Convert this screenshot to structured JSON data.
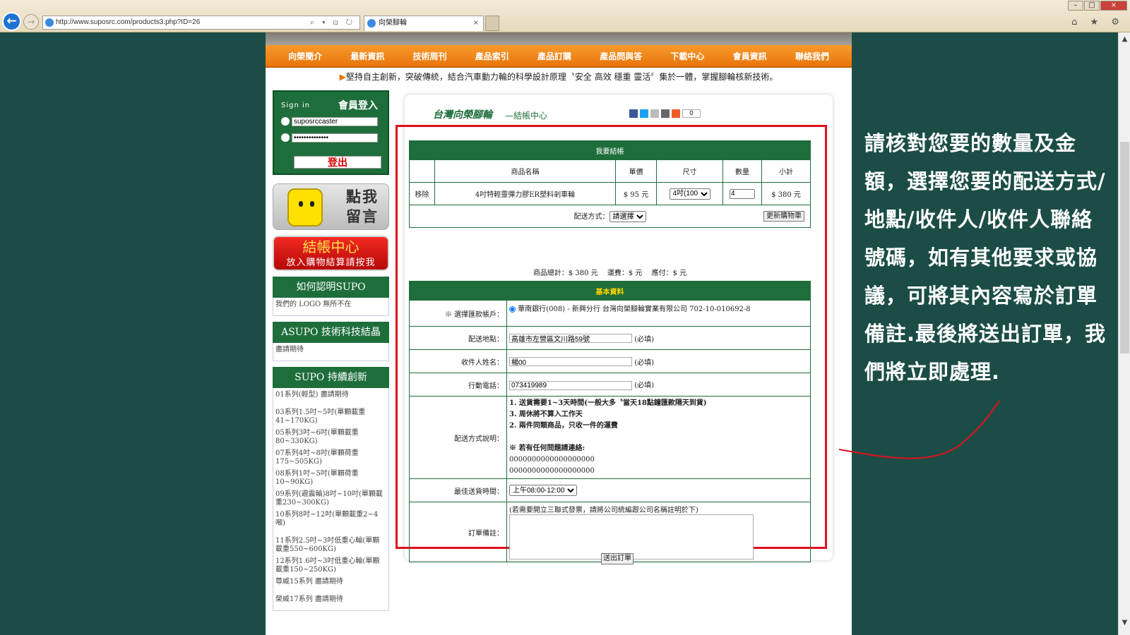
{
  "browser": {
    "url": "http://www.suposrc.com/products3.php?ID=26",
    "tab_title": "向榮腳輪",
    "back_glyph": "←",
    "forward_glyph": "→",
    "close_glyph": "×",
    "min_glyph": "–",
    "max_glyph": "□",
    "addr_tools": "⌕ ▾ ⊡ ↻",
    "right_icons": "⌂ ★ ⚙",
    "scroll_up": "▲",
    "scroll_down": "▼"
  },
  "menu": [
    "向榮簡介",
    "最新資訊",
    "技術周刊",
    "產品索引",
    "產品訂購",
    "產品問與答",
    "下載中心",
    "會員資訊",
    "聯絡我們"
  ],
  "slogan": "堅持自主創新，突破傳統，結合汽車動力輪的科學設計原理〝安全 高效 穩重 靈活〞集於一體，掌握腳輪核新技術。",
  "slogan_marker": "▶",
  "login": {
    "signin": "Sign in",
    "title": "會員登入",
    "username": "suposrccaster",
    "password": "••••••••••••••",
    "logout": "登出"
  },
  "message_button": "點我留言",
  "checkout_button": {
    "title": "結帳中心",
    "subtitle": "放入購物結算請按我"
  },
  "sidebar_sections": [
    {
      "title": "如何認明SUPO",
      "items": [
        "我們的 LOGO 無所不在"
      ]
    },
    {
      "title": "ASUPO 技術科技結晶",
      "items": [
        "盡請期待"
      ]
    },
    {
      "title": "SUPO 持續創新",
      "items": [
        "01系列(輕型) 盡請期待",
        "03系列1.5吋~5吋(單顆載重41~170KG)",
        "05系列3吋~6吋(單顆載重80~330KG)",
        "07系列4吋~8吋(單顆荷重175~505KG)",
        "08系列1吋~5吋(單顆荷重10~90KG)",
        "09系列(避震輪)8吋~10吋(單顆載重230~300KG)",
        "10系列8吋~12吋(單顆載重2~4噸)",
        "11系列2.5吋~3吋低重心輪(單顆載重550~600KG)",
        "12系列1.6吋~3吋低重心輪(單顆載重150~250KG)",
        "尊威15系列 盡請期待",
        "榮威17系列 盡請期待"
      ]
    }
  ],
  "main_header": {
    "title": "台灣向榮腳輪",
    "subtitle": "—結帳中心",
    "share_count": "0"
  },
  "cart": {
    "title": "我要結帳",
    "columns": [
      "",
      "商品名稱",
      "單價",
      "尺寸",
      "數量",
      "小計"
    ],
    "row": {
      "remove": "移除",
      "name": "4吋特輕靈彈力膠ER塑料剎車輪",
      "price": "$ 95 元",
      "size": "4吋(100",
      "qty": "4",
      "subtotal": "$ 380 元"
    },
    "shipping_label": "配送方式：",
    "shipping_value": "請選擇",
    "update_button": "更新購物車"
  },
  "totals": "商品總計：$ 380 元　 運費：$ 元　 應付：$ 元",
  "info": {
    "title": "基本資料",
    "account_label": "※ 選擇匯款帳戶：",
    "account_value": "華南銀行(008) - 新興分行 台灣向榮腳輪實業有限公司 702-10-010692-8",
    "address_label": "配送地點：",
    "address_value": "高雄市左營區文川路59號",
    "name_label": "收件人姓名：",
    "name_value": "楊00",
    "phone_label": "行動電話：",
    "phone_value": "073419989",
    "required": "(必填)",
    "shipping_note_label": "配送方式說明：",
    "shipping_notes": [
      "1. 送貨需要1~3天時間(一般大多〝當天18點鐘匯款隔天到貨)",
      "3. 周休將不算入工作天",
      "2. 兩件同類商品，只收一件的運費",
      "※ 若有任何問題請連絡:",
      "0000000000000000000",
      "0000000000000000000"
    ],
    "time_label": "最佳送貨時間：",
    "time_value": "上午08:00-12:00",
    "remark_label": "訂單備註：",
    "remark_hint": "(若需要開立三聯式發票，請將公司統編跟公司名稱註明於下)"
  },
  "submit_button": "送出訂單",
  "annotation": "請核對您要的數量及金額，選擇您要的配送方式/地點/收件人/收件人聯絡號碼，如有其他要求或協議，可將其內容寫於訂單備註.最後將送出訂單，我們將立即處理.",
  "colors": {
    "menu": "#e9750b",
    "green": "#1e6e3c",
    "highlight": "#e0101e",
    "background": "#1b4d46"
  }
}
